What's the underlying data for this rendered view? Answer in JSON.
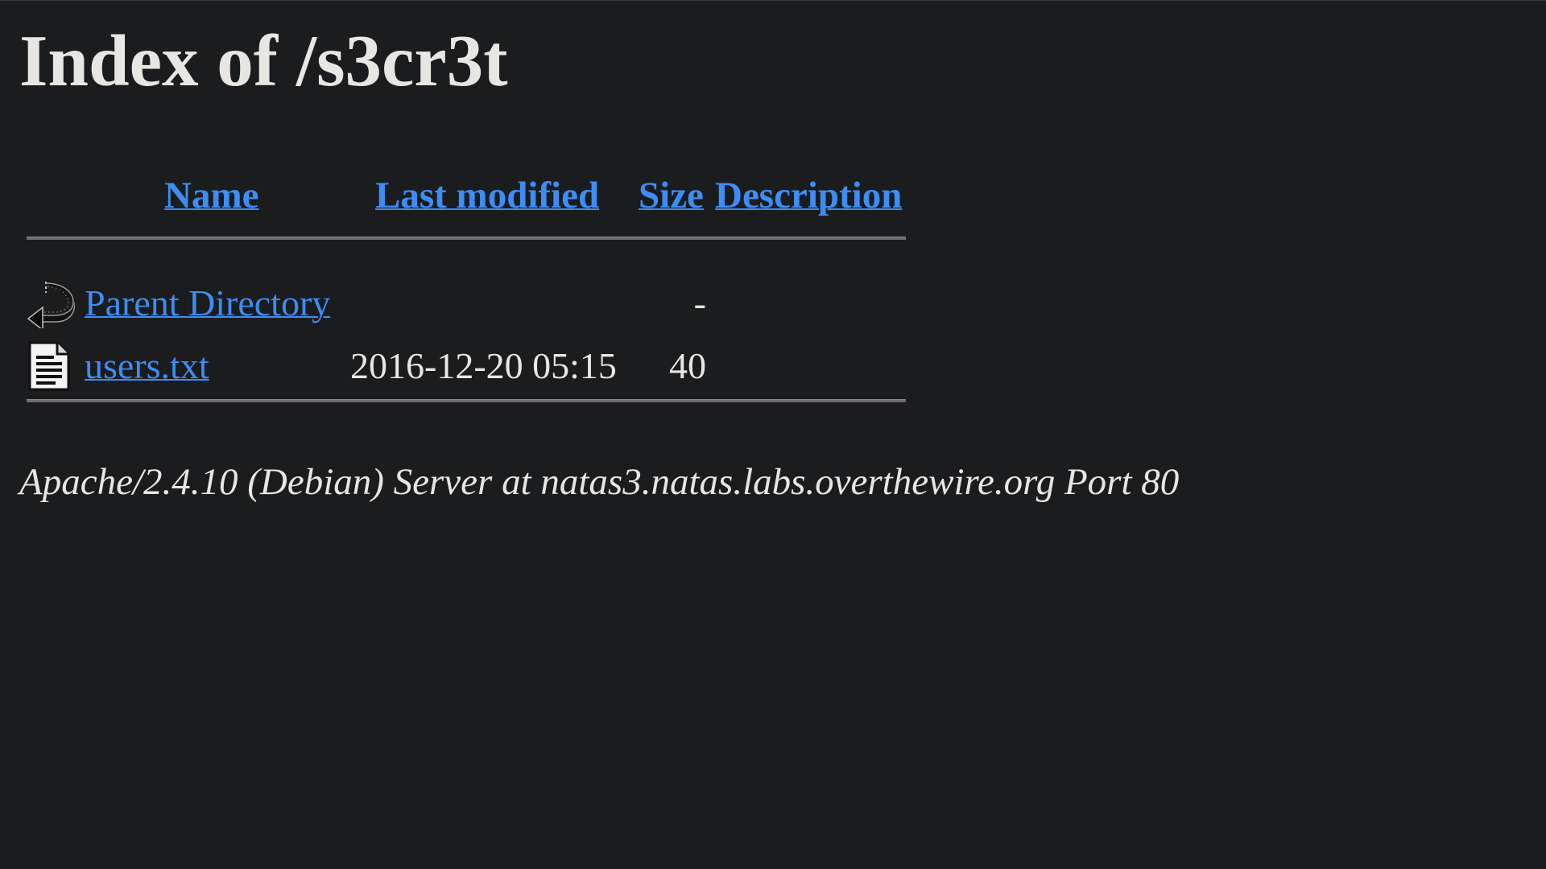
{
  "page": {
    "title": "Index of /s3cr3t"
  },
  "table": {
    "headers": {
      "name": "Name",
      "last_modified": "Last modified",
      "size": "Size",
      "description": "Description"
    },
    "rows": [
      {
        "icon": "back-arrow-icon",
        "name": "Parent Directory",
        "last_modified": "",
        "size": "-",
        "description": ""
      },
      {
        "icon": "text-file-icon",
        "name": "users.txt",
        "last_modified": "2016-12-20 05:15",
        "size": "40",
        "description": ""
      }
    ]
  },
  "footer": {
    "server_signature": "Apache/2.4.10 (Debian) Server at natas3.natas.labs.overthewire.org Port 80"
  },
  "colors": {
    "background": "#1b1c1e",
    "text": "#e8e6e3",
    "link": "#3d8df5",
    "rule": "#6e6e6e"
  }
}
